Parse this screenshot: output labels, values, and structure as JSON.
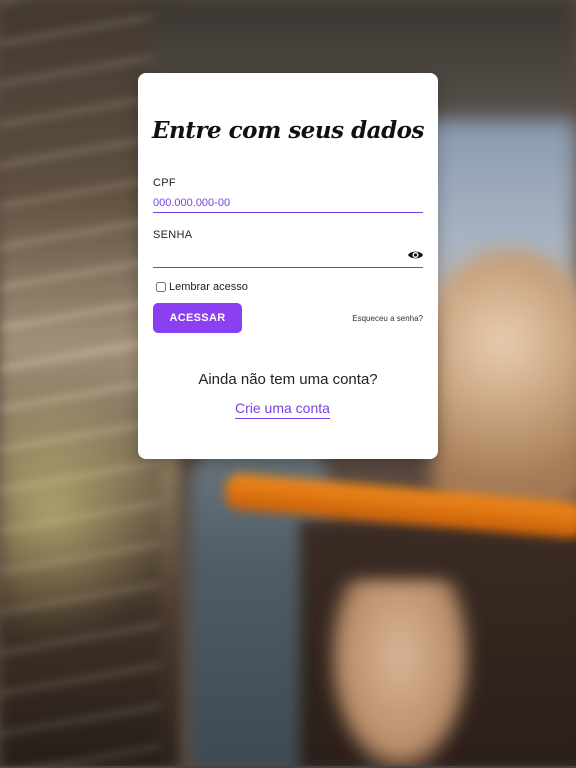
{
  "card": {
    "title": "Entre com seus dados",
    "cpf_label": "CPF",
    "cpf_placeholder": "000.000.000-00",
    "password_label": "SENHA",
    "password_placeholder": "",
    "remember_label": "Lembrar acesso",
    "remember_checked": false,
    "submit_label": "ACESSAR",
    "forgot_label": "Esqueceu a senha?",
    "no_account_text": "Ainda não tem uma conta?",
    "create_account_label": "Crie uma conta",
    "show_password_icon": "eye-icon"
  },
  "colors": {
    "accent": "#8a3ff0",
    "link": "#7b3fe4",
    "card_bg": "#ffffff"
  }
}
